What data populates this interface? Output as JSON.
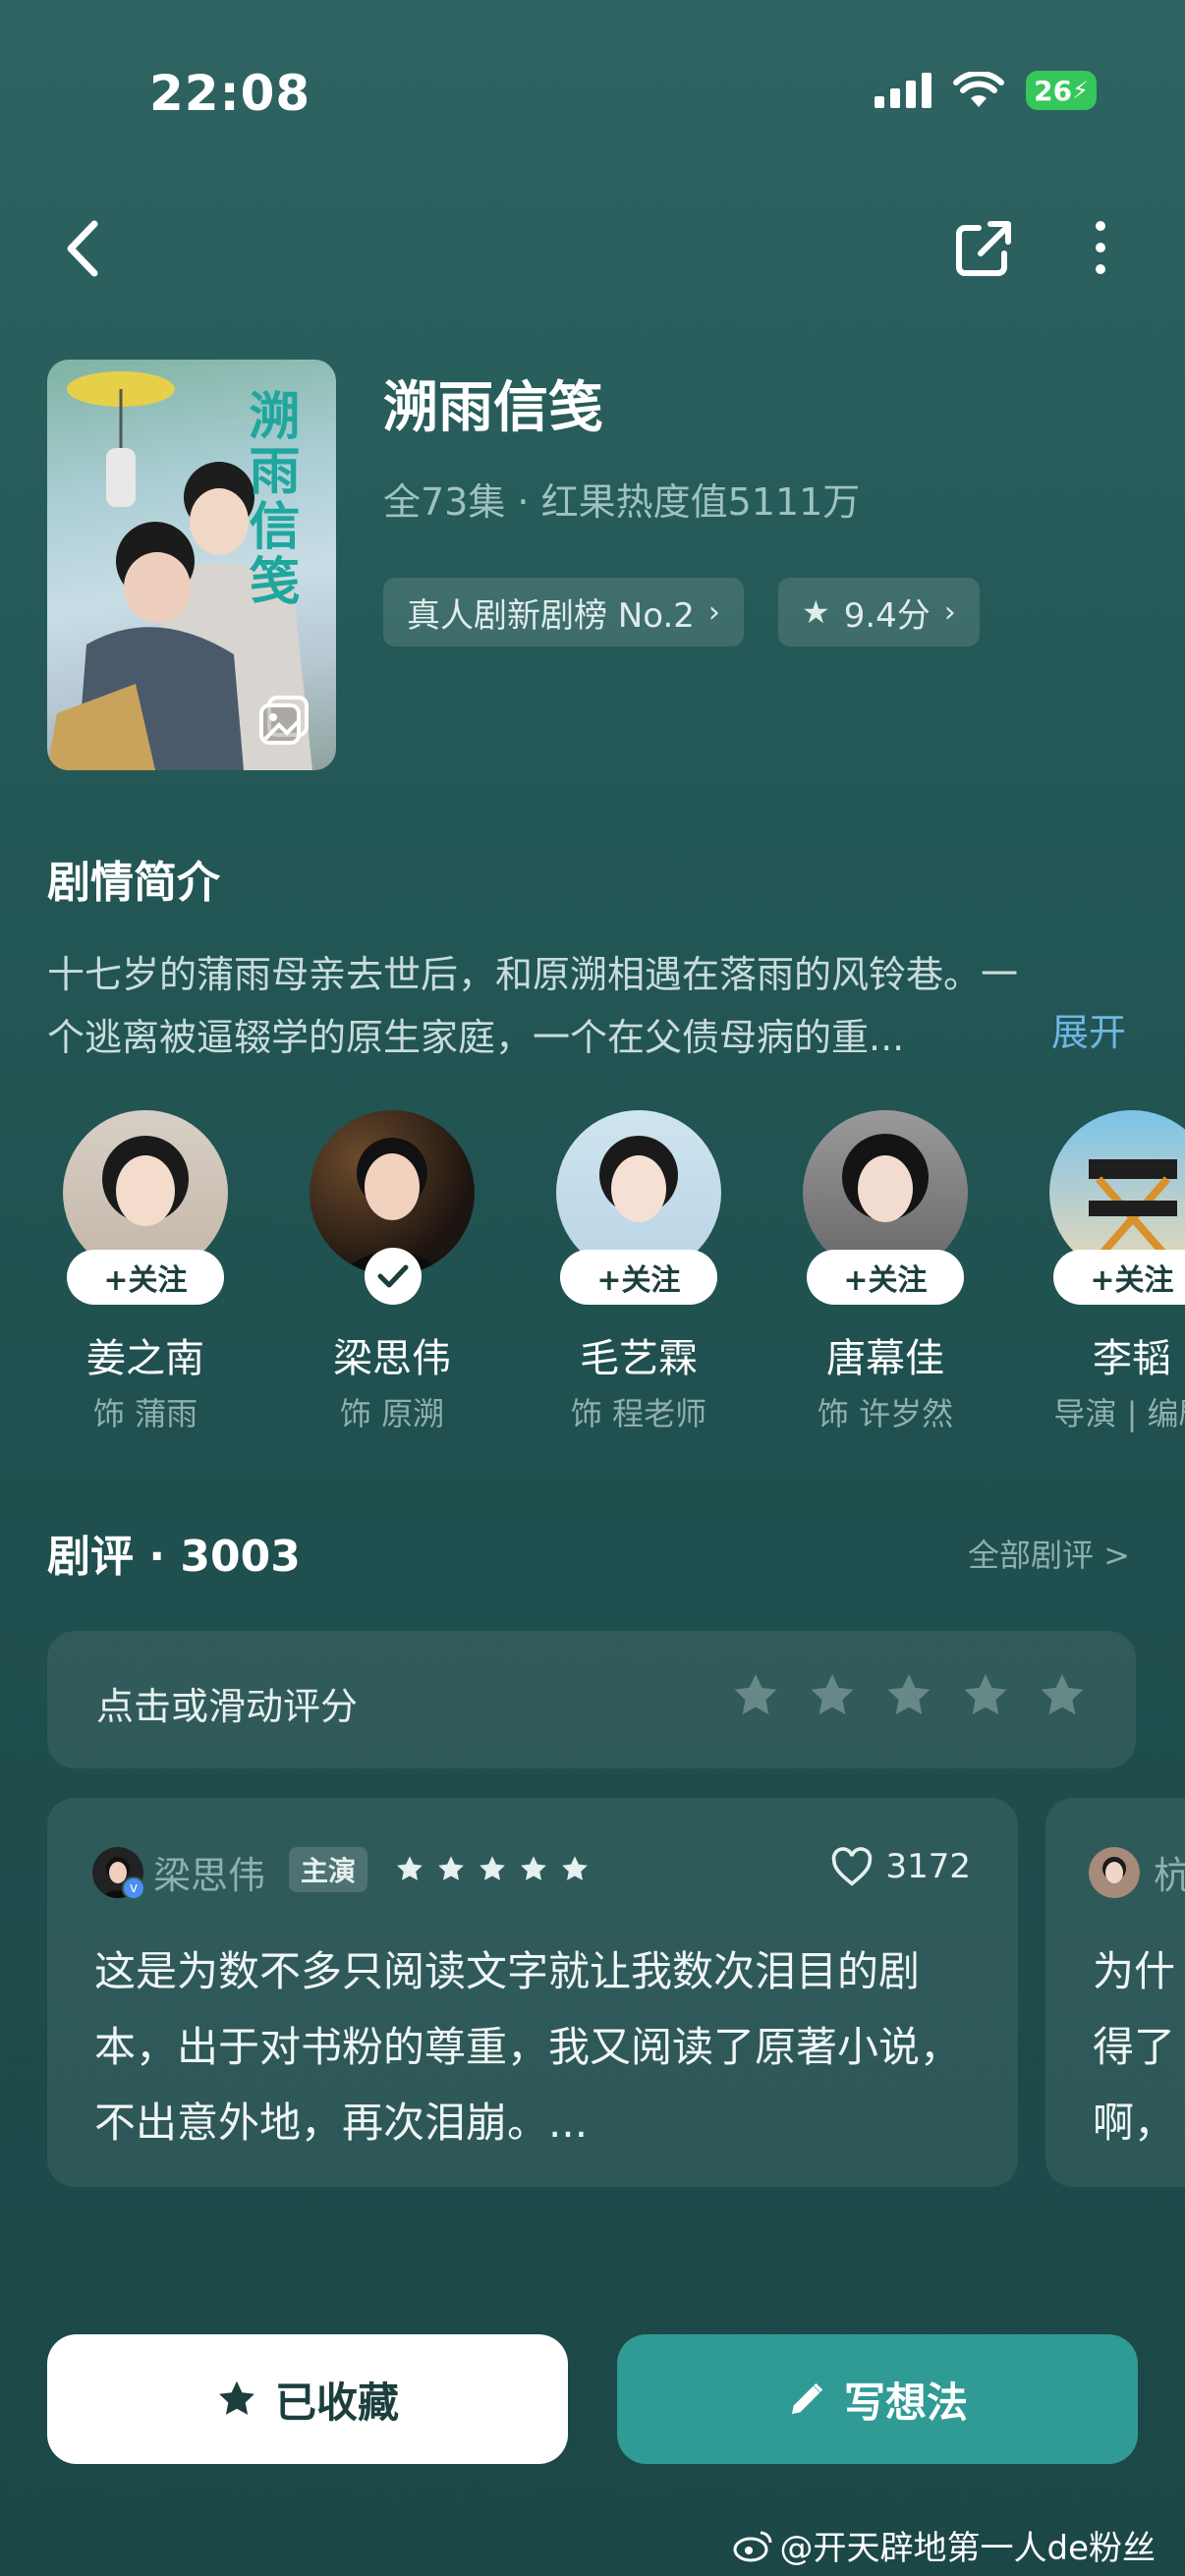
{
  "status_bar": {
    "time": "22:08",
    "battery": "26"
  },
  "drama": {
    "title": "溯雨信笺",
    "meta": "全73集 · 红果热度值5111万",
    "rank_chip": "真人剧新剧榜 No.2",
    "score_chip": "9.4分",
    "poster_title": "溯雨信笺"
  },
  "synopsis": {
    "title": "剧情简介",
    "text": "十七岁的蒲雨母亲去世后，和原溯相遇在落雨的风铃巷。一个逃离被逼辍学的原生家庭，一个在父债母病的重...",
    "expand": "展开"
  },
  "cast": [
    {
      "name": "姜之南",
      "role": "饰 蒲雨",
      "follow": "+关注",
      "followed": false
    },
    {
      "name": "梁思伟",
      "role": "饰 原溯",
      "follow": "",
      "followed": true
    },
    {
      "name": "毛艺霖",
      "role": "饰 程老师",
      "follow": "+关注",
      "followed": false
    },
    {
      "name": "唐幕佳",
      "role": "饰 许岁然",
      "follow": "+关注",
      "followed": false
    },
    {
      "name": "李韬",
      "role": "导演 | 编剧",
      "follow": "+关注",
      "followed": false
    }
  ],
  "reviews": {
    "title": "剧评 · 3003",
    "all_label": "全部剧评 >",
    "rate_prompt": "点击或滑动评分",
    "items": [
      {
        "user": "梁思伟",
        "tag": "主演",
        "likes": "3172",
        "text": "这是为数不多只阅读文字就让我数次泪目的剧本，出于对书粉的尊重，我又阅读了原著小说，不出意外地，再次泪崩。..."
      },
      {
        "user": "杭",
        "text": "为什\n得了\n啊，"
      }
    ]
  },
  "actions": {
    "collected": "已收藏",
    "write": "写想法"
  },
  "watermark": "@开天辟地第一人de粉丝",
  "colors": {
    "accent": "#2f9b94",
    "link": "#6fb7e6",
    "battery": "#35c759"
  }
}
